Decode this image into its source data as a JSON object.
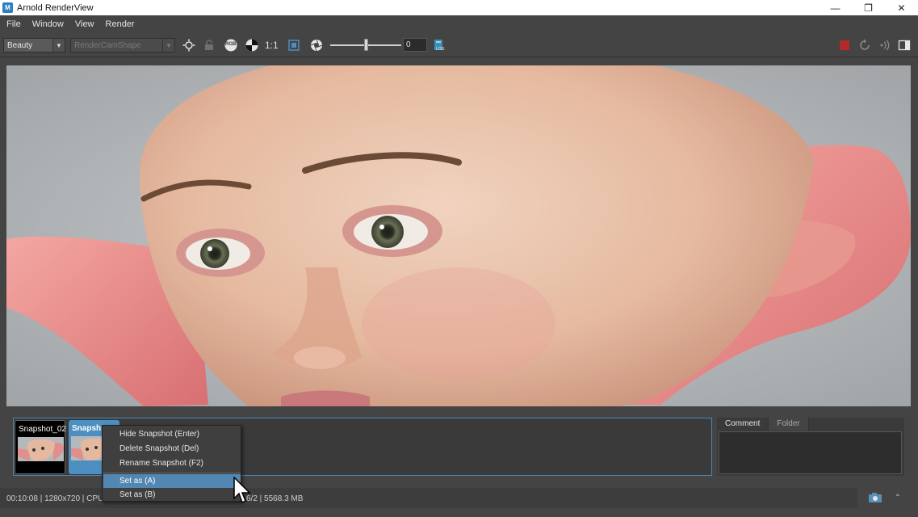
{
  "window": {
    "title": "Arnold RenderView",
    "app_icon": "M"
  },
  "menu": [
    "File",
    "Window",
    "View",
    "Render"
  ],
  "toolbar": {
    "aov": "Beauty",
    "camera": "RenderCamShape",
    "rgb_label": "RGB",
    "zoom_label": "1:1",
    "exposure_value": "0",
    "log_label": "LOG"
  },
  "snapshots": [
    {
      "name": "Snapshot_02"
    },
    {
      "name": "Snapsh"
    }
  ],
  "context_menu": {
    "items": [
      "Hide Snapshot  (Enter)",
      "Delete Snapshot  (Del)",
      "Rename Snapshot  (F2)",
      "Set as (A)",
      "Set as (B)"
    ],
    "highlighted_index": 3
  },
  "panel": {
    "tabs": [
      "Comment",
      "Folder"
    ],
    "active_tab": "Comment"
  },
  "status": {
    "left": "00:10:08 | 1280x720 | CPU",
    "right": "6/2 | 5568.3 MB"
  },
  "colors": {
    "background": "#444444",
    "accent": "#5287b3",
    "stop_button": "#b32a2a"
  }
}
